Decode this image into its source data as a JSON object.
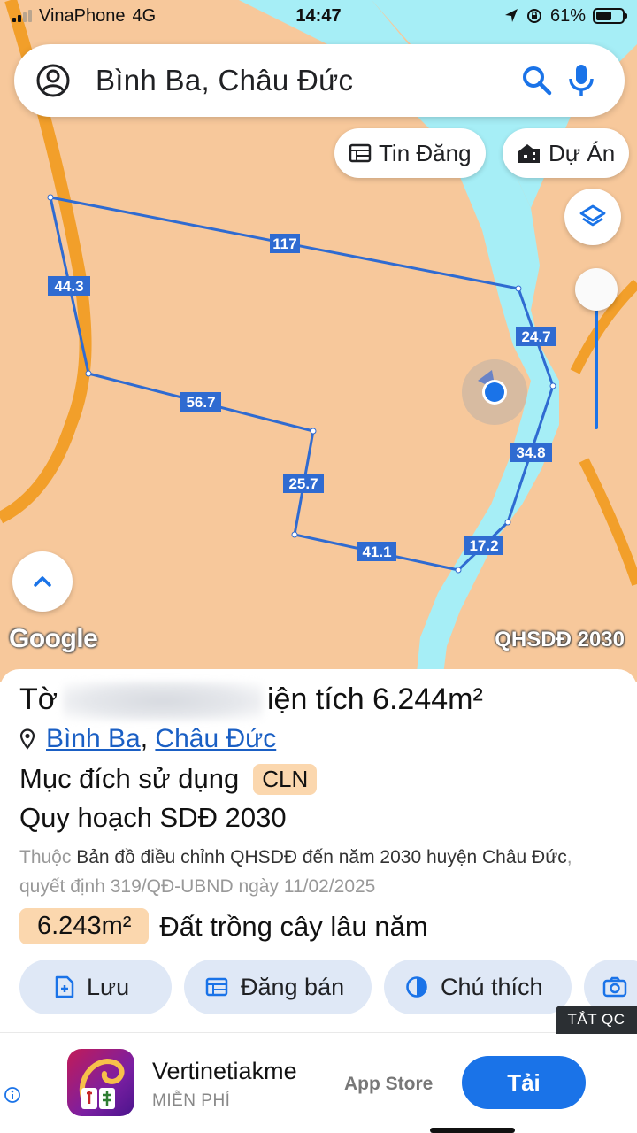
{
  "status_bar": {
    "carrier": "VinaPhone",
    "network": "4G",
    "time": "14:47",
    "battery": "61%",
    "battery_level": 0.61
  },
  "search": {
    "value": "Bình Ba, Châu Đức"
  },
  "map_chips": {
    "listings": "Tin Đăng",
    "projects": "Dự Án"
  },
  "map": {
    "edge_lengths": [
      "117",
      "24.7",
      "34.8",
      "17.2",
      "41.1",
      "25.7",
      "56.7",
      "44.3"
    ],
    "logo": "Google",
    "layer_label": "QHSDĐ 2030",
    "colors": {
      "land": "#f7c89b",
      "water": "#a6eef6",
      "road": "#f29f2a",
      "boundary": "#2f6bd1",
      "label_bg": "#2f6bd1"
    }
  },
  "parcel": {
    "title_start": "Tờ",
    "title_end": "iện tích 6.244m²",
    "commune": "Bình Ba",
    "district": "Châu Đức",
    "purpose_label": "Mục đích sử dụng",
    "purpose_code": "CLN",
    "plan_title": "Quy hoạch SDĐ 2030",
    "desc_prefix": "Thuộc",
    "desc_main": "Bản đồ điều chỉnh QHSDĐ đến năm 2030 huyện Châu Đức",
    "desc_suffix": ", quyết định 319/QĐ-UBND ngày 11/02/2025",
    "area_value": "6.243m²",
    "area_use": "Đất trồng cây lâu năm"
  },
  "actions": {
    "save": "Lưu",
    "sell": "Đăng bán",
    "legend": "Chú thích"
  },
  "ad": {
    "hide_label": "TẮT QC",
    "app_name": "Vertinetiakme",
    "price": "MIỄN PHÍ",
    "store": "App Store",
    "install": "Tải"
  }
}
